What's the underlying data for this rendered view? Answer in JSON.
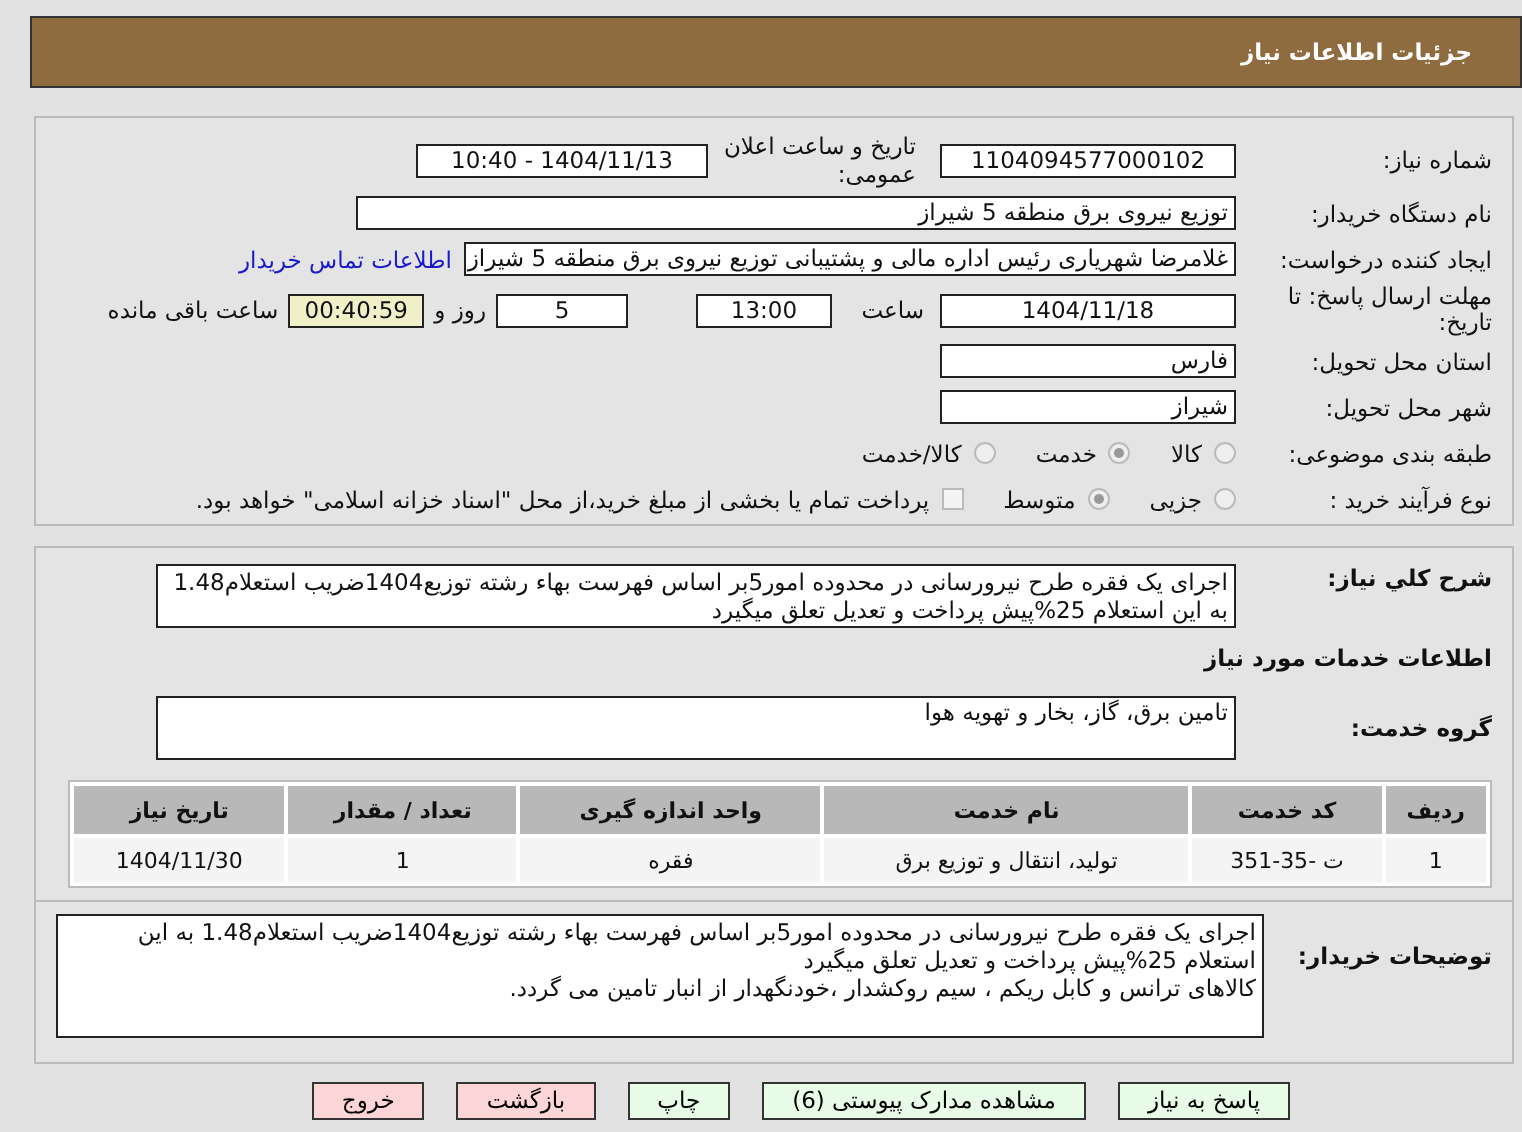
{
  "header": {
    "title": "جزئیات اطلاعات نیاز"
  },
  "need_number": {
    "label": "شماره نیاز:",
    "value": "1104094577000102"
  },
  "announce": {
    "label": "تاریخ و ساعت اعلان عمومی:",
    "value": "1404/11/13 - 10:40"
  },
  "buyer_org": {
    "label": "نام دستگاه خریدار:",
    "value": "توزیع نیروی برق منطقه 5 شیراز"
  },
  "creator": {
    "label": "ایجاد کننده درخواست:",
    "value": "غلامرضا شهریاری رئیس اداره مالی و پشتیبانی توزیع نیروی برق منطقه 5 شیراز",
    "link": "اطلاعات تماس خریدار"
  },
  "deadline": {
    "label": "مهلت ارسال پاسخ: تا تاریخ:",
    "date": "1404/11/18",
    "time_label": "ساعت",
    "time": "13:00",
    "days": "5",
    "days_label": "روز و",
    "remaining": "00:40:59",
    "remaining_label": "ساعت باقی مانده"
  },
  "province": {
    "label": "استان محل تحویل:",
    "value": "فارس"
  },
  "city": {
    "label": "شهر محل تحویل:",
    "value": "شیراز"
  },
  "category": {
    "label": "طبقه بندی موضوعی:",
    "options": [
      {
        "label": "کالا",
        "selected": false
      },
      {
        "label": "خدمت",
        "selected": true
      },
      {
        "label": "کالا/خدمت",
        "selected": false
      }
    ]
  },
  "purchase_type": {
    "label": "نوع فرآیند خرید :",
    "options": [
      {
        "label": "جزیی",
        "selected": false
      },
      {
        "label": "متوسط",
        "selected": true
      }
    ],
    "treasury": {
      "checked": false,
      "text": "پرداخت تمام یا بخشی از مبلغ خرید،از محل \"اسناد خزانه اسلامی\" خواهد بود."
    }
  },
  "summary": {
    "label": "شرح کلي نیاز:",
    "value": "اجرای یک فقره طرح نیرورسانی در محدوده امور5بر اساس فهرست بهاء رشته توزیع1404ضریب استعلام1.48 به این استعلام 25%پیش پرداخت و تعدیل تعلق میگیرد"
  },
  "services_heading": "اطلاعات خدمات مورد نیاز",
  "service_group": {
    "label": "گروه خدمت:",
    "value": "تامین برق، گاز، بخار و تهویه هوا"
  },
  "table": {
    "columns": [
      "ردیف",
      "کد خدمت",
      "نام خدمت",
      "واحد اندازه گیری",
      "تعداد / مقدار",
      "تاریخ نیاز"
    ],
    "rows": [
      [
        "1",
        "ت -35-351",
        "تولید، انتقال و توزیع برق",
        "فقره",
        "1",
        "1404/11/30"
      ]
    ]
  },
  "buyer_notes": {
    "label": "توضیحات خریدار:",
    "value": "اجرای یک فقره طرح نیرورسانی در محدوده امور5بر اساس فهرست بهاء رشته توزیع1404ضریب استعلام1.48 به این استعلام 25%پیش پرداخت و تعدیل تعلق میگیرد\nکالاهای ترانس و کابل ریکم ، سیم روکشدار ،خودنگهدار از انبار تامین می گردد."
  },
  "buttons": [
    {
      "label": "پاسخ به نیاز",
      "kind": "primary"
    },
    {
      "label": "مشاهده مدارک پیوستی (6)",
      "kind": "primary"
    },
    {
      "label": "چاپ",
      "kind": "primary"
    },
    {
      "label": "بازگشت",
      "kind": "danger"
    },
    {
      "label": "خروج",
      "kind": "danger"
    }
  ]
}
